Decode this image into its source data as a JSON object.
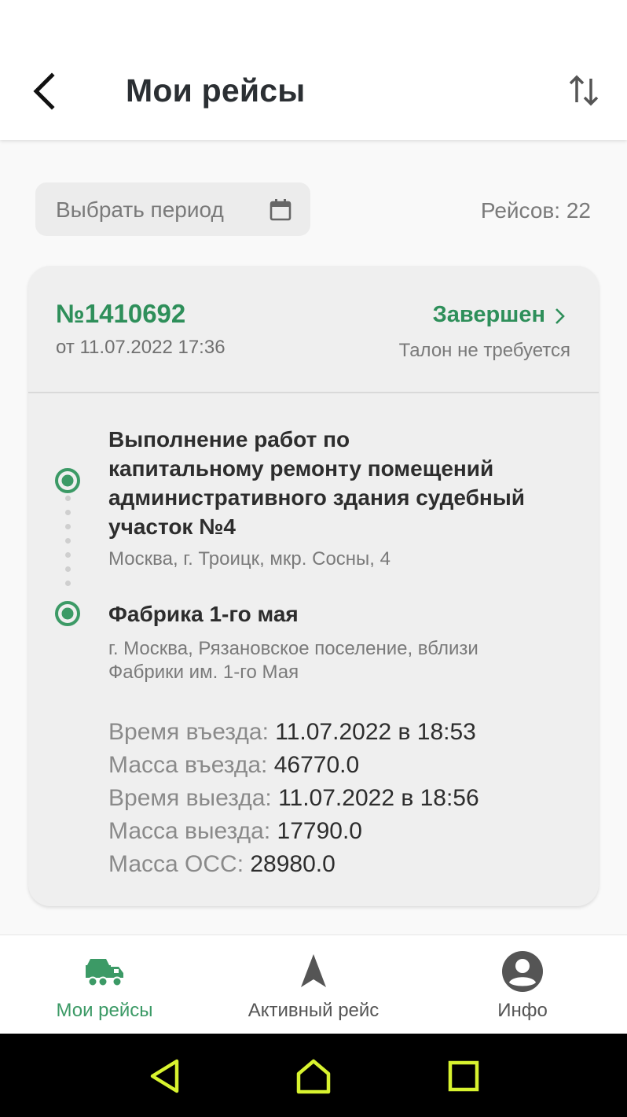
{
  "header": {
    "title": "Мои рейсы"
  },
  "filter": {
    "period_label": "Выбрать период",
    "trips_count": "Рейсов: 22"
  },
  "trip": {
    "number": "№1410692",
    "date": "от 11.07.2022 17:36",
    "status": "Завершен",
    "ticket": "Талон не требуется",
    "from": {
      "title_lines": [
        "Выполнение работ по",
        "капитальному ремонту помещений",
        "административного здания судебный",
        "участок №4"
      ],
      "address": "Москва, г. Троицк, мкр. Сосны, 4"
    },
    "to": {
      "title": "Фабрика 1-го мая",
      "address_lines": [
        "г. Москва, Рязановское поселение, вблизи",
        "Фабрики им. 1-го Мая"
      ]
    },
    "stats": [
      {
        "label": "Время въезда:",
        "value": "11.07.2022 в 18:53"
      },
      {
        "label": "Масса въезда:",
        "value": "46770.0"
      },
      {
        "label": "Время выезда:",
        "value": "11.07.2022 в 18:56"
      },
      {
        "label": "Масса выезда:",
        "value": "17790.0"
      },
      {
        "label": "Масса ОСС:",
        "value": "28980.0"
      }
    ]
  },
  "nav": [
    {
      "label": "Мои рейсы",
      "icon": "truck-icon",
      "active": true
    },
    {
      "label": "Активный рейс",
      "icon": "navigation-arrow-icon",
      "active": false
    },
    {
      "label": "Инфо",
      "icon": "account-icon",
      "active": false
    }
  ],
  "system_nav": {
    "icons": [
      "back-triangle-icon",
      "home-icon",
      "recents-square-icon"
    ],
    "color": "#d8f32f"
  },
  "colors": {
    "accent": "#2e8f5a",
    "nav_active": "#3c9a66"
  }
}
